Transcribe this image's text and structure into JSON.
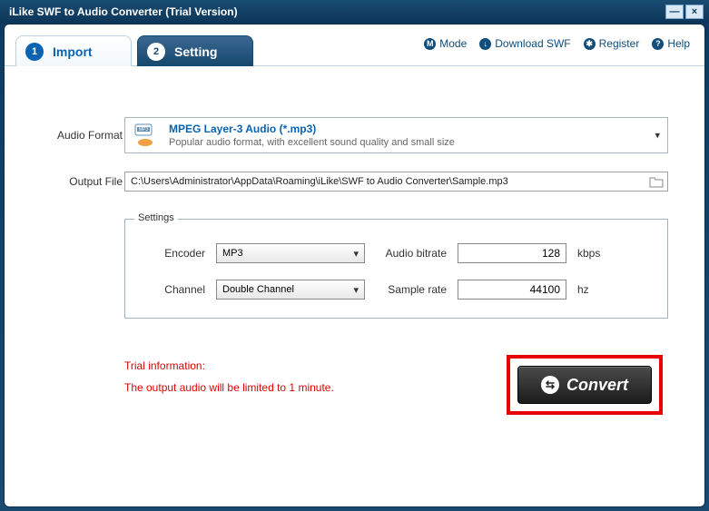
{
  "titlebar": {
    "title": "iLike SWF to Audio Converter (Trial Version)"
  },
  "tabs": [
    {
      "num": "1",
      "label": "Import"
    },
    {
      "num": "2",
      "label": "Setting"
    }
  ],
  "nav": {
    "mode": "Mode",
    "download": "Download SWF",
    "register": "Register",
    "help": "Help",
    "icons": {
      "mode": "M",
      "download": "↓",
      "register": "✱",
      "help": "?"
    }
  },
  "labels": {
    "audio_format": "Audio Format",
    "output_file": "Output File",
    "settings_legend": "Settings",
    "encoder": "Encoder",
    "channel": "Channel",
    "audio_bitrate": "Audio bitrate",
    "sample_rate": "Sample rate",
    "kbps": "kbps",
    "hz": "hz"
  },
  "format": {
    "title": "MPEG Layer-3 Audio (*.mp3)",
    "subtitle": "Popular audio format, with excellent sound quality and small size"
  },
  "output_path": "C:\\Users\\Administrator\\AppData\\Roaming\\iLike\\SWF to Audio Converter\\Sample.mp3",
  "settings": {
    "encoder": "MP3",
    "channel": "Double Channel",
    "audio_bitrate": "128",
    "sample_rate": "44100"
  },
  "trial": {
    "title": "Trial information:",
    "message": "The output audio will be limited to 1 minute."
  },
  "convert": {
    "label": "Convert",
    "icon": "⇆"
  }
}
